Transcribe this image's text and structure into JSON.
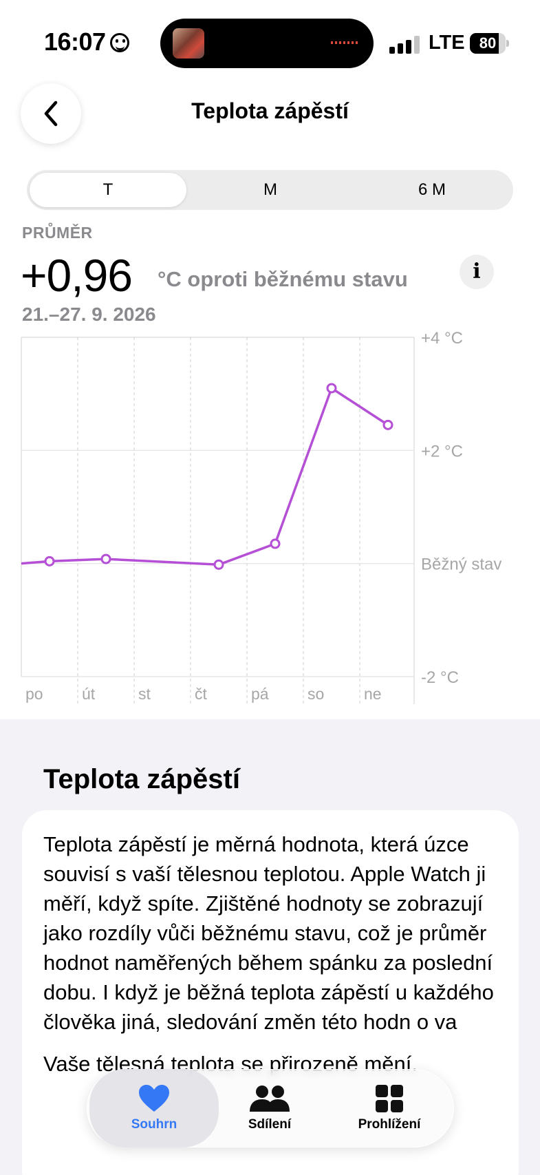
{
  "status_bar": {
    "time": "16:07",
    "network": "LTE",
    "battery_level": 80,
    "battery_label": "80",
    "signal_bars_active": 3,
    "signal_bars_total": 4
  },
  "header": {
    "back_icon": "chevron-left-icon",
    "title": "Teplota zápěstí"
  },
  "segments": [
    {
      "label": "T",
      "selected": true
    },
    {
      "label": "M",
      "selected": false
    },
    {
      "label": "6 M",
      "selected": false
    }
  ],
  "summary": {
    "label": "PRŮMĚR",
    "value": "+0,96",
    "unit": "°C oproti běžnému stavu",
    "date_range": "21.–27. 9. 2026",
    "info_icon": "info-icon"
  },
  "chart_data": {
    "type": "line",
    "categories": [
      "po",
      "út",
      "st",
      "čt",
      "pá",
      "so",
      "ne"
    ],
    "ylim": [
      -2,
      4
    ],
    "y_tick_labels": [
      {
        "value": 4,
        "label": "+4 °C"
      },
      {
        "value": 2,
        "label": "+2 °C"
      },
      {
        "value": 0,
        "label": "Běžný stav"
      },
      {
        "value": -2,
        "label": "-2 °C"
      }
    ],
    "series": [
      {
        "values": [
          0.04,
          0.08,
          null,
          -0.02,
          0.35,
          3.1,
          2.45
        ],
        "color": "#b44fd6"
      }
    ],
    "line_start_value": 0.0,
    "grid": true
  },
  "about": {
    "title": "Teplota zápěstí",
    "paragraph1": "Teplota zápěstí je měrná hodnota, která úzce souvisí s vaší tělesnou teplotou. Apple Watch ji měří, když spíte. Zjištěné hodnoty se zobrazují jako rozdíly vůči běžnému stavu, což je průměr hodnot naměřených během spánku za poslední dobu. I když je běžná teplota zápěstí u každého člověka jiná, sledování změn této hodn o va",
    "paragraph2": "Vaše tělesná teplota se přirozeně mění."
  },
  "tab_bar": {
    "items": [
      {
        "label": "Souhrn",
        "icon": "heart-icon",
        "selected": true
      },
      {
        "label": "Sdílení",
        "icon": "people-icon",
        "selected": false
      },
      {
        "label": "Prohlížení",
        "icon": "grid-icon",
        "selected": false
      }
    ]
  },
  "colors": {
    "accent": "#3478f6",
    "series": "#b44fd6",
    "secondary_text": "#8a8a8e",
    "section_background": "#f2f2f7"
  }
}
